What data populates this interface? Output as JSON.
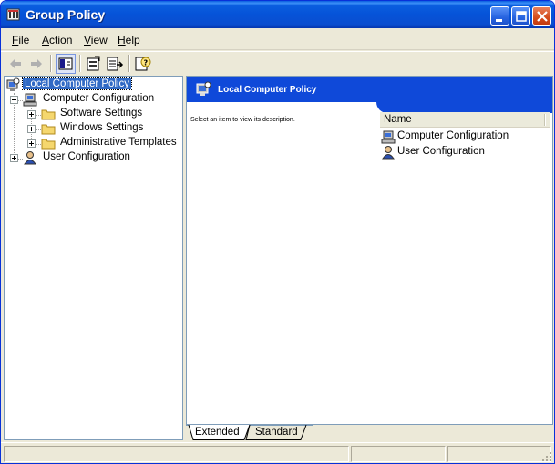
{
  "window": {
    "title": "Group Policy"
  },
  "menu": {
    "file": {
      "u": "F",
      "rest": "ile"
    },
    "action": {
      "u": "A",
      "rest": "ction"
    },
    "view": {
      "u": "V",
      "rest": "iew"
    },
    "help": {
      "u": "H",
      "rest": "elp"
    }
  },
  "tree": {
    "root": "Local Computer Policy",
    "computer_configuration": "Computer Configuration",
    "software_settings": "Software Settings",
    "windows_settings": "Windows Settings",
    "administrative_templates": "Administrative Templates",
    "user_configuration": "User Configuration"
  },
  "right_pane": {
    "title": "Local Computer Policy",
    "description": "Select an item to view its description.",
    "column_name": "Name",
    "items": [
      "Computer Configuration",
      "User Configuration"
    ]
  },
  "tabs": {
    "extended": "Extended",
    "standard": "Standard"
  },
  "colors": {
    "title_blue": "#0a5ddf",
    "header_blue": "#0f49d9",
    "selection": "#316ac5",
    "chrome": "#ece9d8"
  }
}
